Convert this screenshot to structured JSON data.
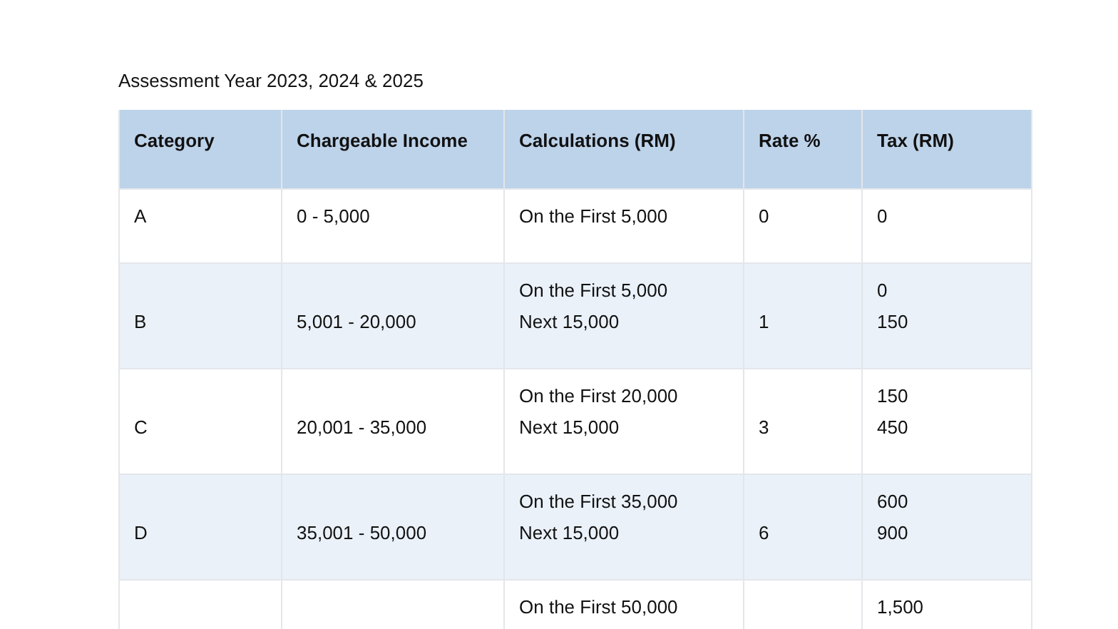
{
  "title": "Assessment Year 2023, 2024 & 2025",
  "table": {
    "columns": [
      "Category",
      "Chargeable Income",
      "Calculations (RM)",
      "Rate %",
      "Tax (RM)"
    ],
    "rows": [
      {
        "category": "A",
        "income": "0 - 5,000",
        "calculations": [
          "On the First 5,000"
        ],
        "rate": "0",
        "tax": [
          "0"
        ]
      },
      {
        "category": "B",
        "income": "5,001 - 20,000",
        "calculations": [
          "On the First 5,000",
          "Next 15,000"
        ],
        "rate": "1",
        "tax": [
          "0",
          "150"
        ]
      },
      {
        "category": "C",
        "income": "20,001 - 35,000",
        "calculations": [
          "On the First 20,000",
          "Next 15,000"
        ],
        "rate": "3",
        "tax": [
          "150",
          "450"
        ]
      },
      {
        "category": "D",
        "income": "35,001 - 50,000",
        "calculations": [
          "On the First 35,000",
          "Next 15,000"
        ],
        "rate": "6",
        "tax": [
          "600",
          "900"
        ]
      },
      {
        "calculations": [
          "On the First 50,000"
        ],
        "tax": [
          "1,500"
        ]
      }
    ]
  }
}
